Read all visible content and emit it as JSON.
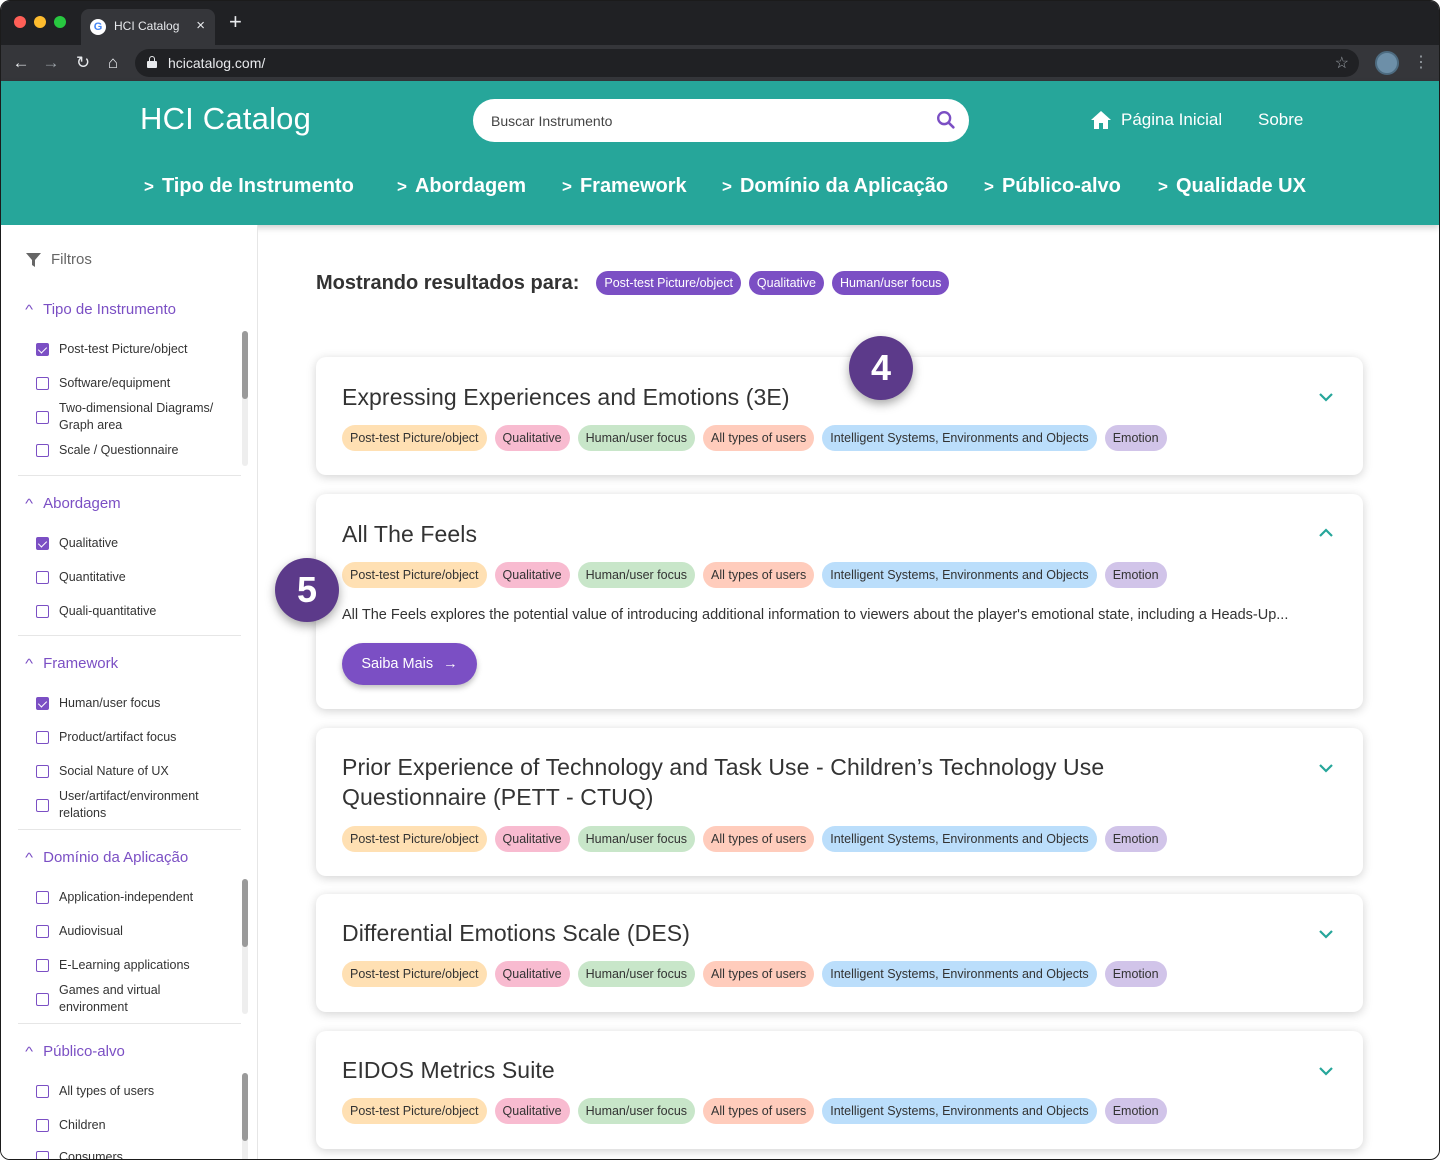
{
  "browser": {
    "tab_title": "HCI Catalog",
    "tab_favicon": "G",
    "url": "hcicatalog.com/"
  },
  "header": {
    "logo": "HCI Catalog",
    "search_placeholder": "Buscar Instrumento",
    "home_label": "Página Inicial",
    "about_label": "Sobre",
    "accent_color": "#26a69a",
    "categories": [
      "Tipo de Instrumento",
      "Abordagem",
      "Framework",
      "Domínio da Aplicação",
      "Público-alvo",
      "Qualidade UX"
    ]
  },
  "sidebar": {
    "title": "Filtros",
    "groups": [
      {
        "title": "Tipo de Instrumento",
        "options": [
          {
            "label": "Post-test Picture/object",
            "checked": true
          },
          {
            "label": "Software/equipment",
            "checked": false
          },
          {
            "label": "Two-dimensional Diagrams/ Graph area",
            "checked": false
          },
          {
            "label": "Scale / Questionnaire",
            "checked": false
          }
        ]
      },
      {
        "title": "Abordagem",
        "options": [
          {
            "label": "Qualitative",
            "checked": true
          },
          {
            "label": "Quantitative",
            "checked": false
          },
          {
            "label": "Quali-quantitative",
            "checked": false
          }
        ]
      },
      {
        "title": "Framework",
        "options": [
          {
            "label": "Human/user focus",
            "checked": true
          },
          {
            "label": "Product/artifact focus",
            "checked": false
          },
          {
            "label": "Social Nature of UX",
            "checked": false
          },
          {
            "label": "User/artifact/environment relations",
            "checked": false
          }
        ]
      },
      {
        "title": "Domínio da Aplicação",
        "options": [
          {
            "label": "Application-independent",
            "checked": false
          },
          {
            "label": "Audiovisual",
            "checked": false
          },
          {
            "label": "E-Learning applications",
            "checked": false
          },
          {
            "label": "Games and virtual environment",
            "checked": false
          }
        ]
      },
      {
        "title": "Público-alvo",
        "options": [
          {
            "label": "All types of users",
            "checked": false
          },
          {
            "label": "Children",
            "checked": false
          },
          {
            "label": "Consumers",
            "checked": false
          }
        ]
      }
    ]
  },
  "results": {
    "label": "Mostrando resultados para:",
    "active_filters": [
      "Post-test Picture/object",
      "Qualitative",
      "Human/user focus"
    ],
    "tags": [
      "Post-test Picture/object",
      "Qualitative",
      "Human/user focus",
      "All types of users",
      "Intelligent Systems, Environments and Objects",
      "Emotion"
    ],
    "cards": [
      {
        "title": "Expressing Experiences and Emotions (3E)",
        "expanded": false
      },
      {
        "title": "All The Feels",
        "expanded": true,
        "description": "All The Feels explores the potential value of introducing additional information to viewers about the player's emotional state, including a Heads-Up...",
        "button": "Saiba Mais"
      },
      {
        "title": "Prior Experience of Technology and Task Use - Children’s Technology Use Questionnaire (PETT - CTUQ)",
        "expanded": false
      },
      {
        "title": "Differential Emotions Scale (DES)",
        "expanded": false
      },
      {
        "title": "EIDOS Metrics Suite",
        "expanded": false
      }
    ]
  },
  "annotations": {
    "badge_a": "4",
    "badge_b": "5"
  }
}
